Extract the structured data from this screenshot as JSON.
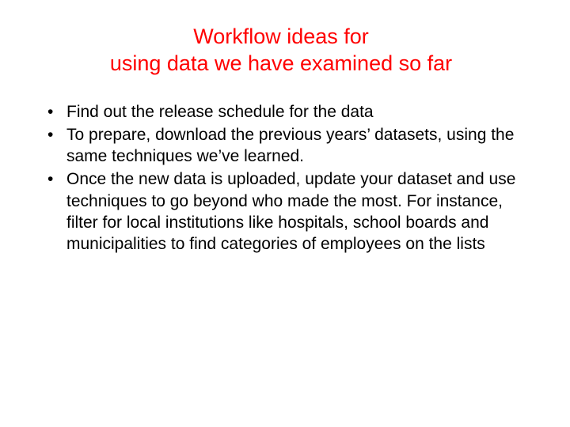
{
  "title_line1": "Workflow ideas for",
  "title_line2": "using data we have examined so far",
  "bullets": {
    "0": "Find out the release schedule for the data",
    "1": "To prepare, download the previous years’ datasets, using the same techniques we’ve learned.",
    "2": "Once the new data is uploaded, update your dataset and use techniques to go beyond who made the most. For instance, filter for local institutions like hospitals, school boards and municipalities to find categories of employees on the lists"
  }
}
